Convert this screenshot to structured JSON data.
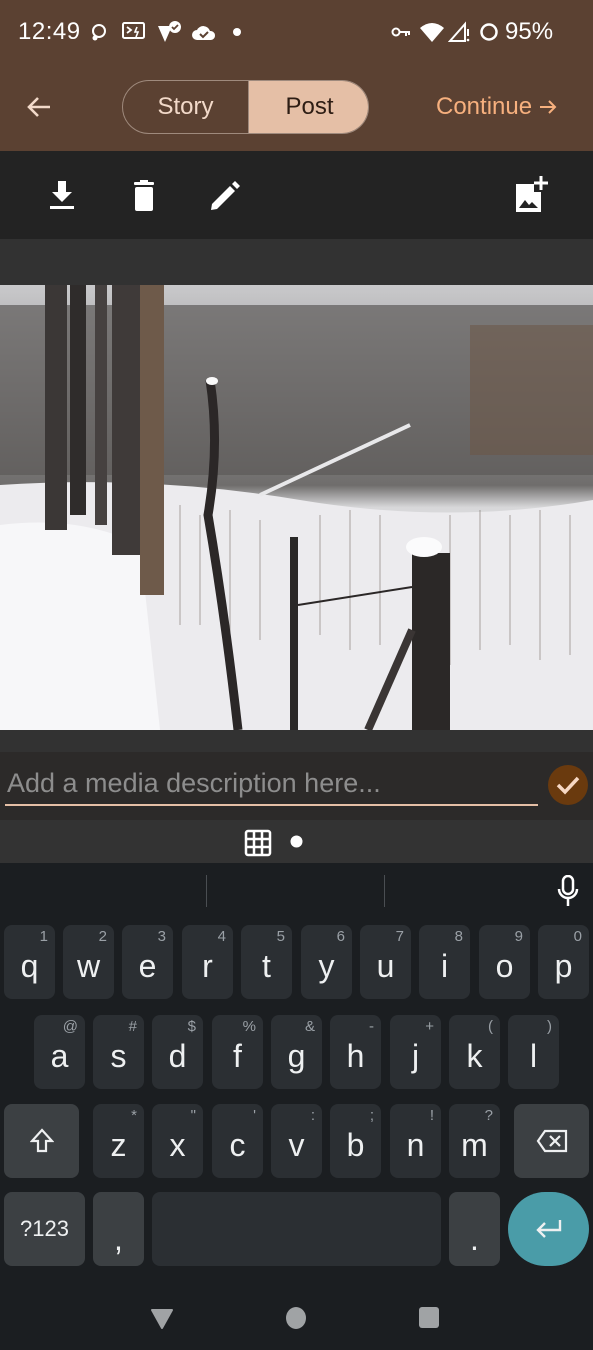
{
  "status_bar": {
    "time": "12:49",
    "left_icons": [
      "sync-icon",
      "terminal-notification-icon",
      "vpn-check-icon",
      "cloud-check-icon",
      "dot-icon"
    ],
    "right_icons": [
      "vpn-key-icon",
      "wifi-icon",
      "signal-no-data-icon",
      "battery-ring-icon"
    ],
    "battery": "95%"
  },
  "app_bar": {
    "back_icon": "arrow-left-icon",
    "segments": [
      {
        "label": "Story",
        "selected": false
      },
      {
        "label": "Post",
        "selected": true
      }
    ],
    "continue_label": "Continue",
    "continue_icon": "arrow-right-icon"
  },
  "toolbar": {
    "actions": [
      {
        "name": "download",
        "icon": "download-icon"
      },
      {
        "name": "delete",
        "icon": "trash-icon"
      },
      {
        "name": "edit",
        "icon": "pencil-icon"
      },
      {
        "name": "add-media",
        "icon": "add-photo-icon"
      }
    ]
  },
  "media": {
    "description": "Snowy forest trail with bare trees and a wooden fence post",
    "alt": "winter-forest-photo"
  },
  "caption": {
    "value": "",
    "placeholder": "Add a media description here...",
    "confirm_icon": "checkmark-icon"
  },
  "keyboard": {
    "toolbar_icons": [
      "grid-icon",
      "dot-indicator-icon"
    ],
    "mic_icon": "microphone-icon",
    "rows": [
      [
        {
          "ch": "q",
          "hint": "1"
        },
        {
          "ch": "w",
          "hint": "2"
        },
        {
          "ch": "e",
          "hint": "3"
        },
        {
          "ch": "r",
          "hint": "4"
        },
        {
          "ch": "t",
          "hint": "5"
        },
        {
          "ch": "y",
          "hint": "6"
        },
        {
          "ch": "u",
          "hint": "7"
        },
        {
          "ch": "i",
          "hint": "8"
        },
        {
          "ch": "o",
          "hint": "9"
        },
        {
          "ch": "p",
          "hint": "0"
        }
      ],
      [
        {
          "ch": "a",
          "hint": "@"
        },
        {
          "ch": "s",
          "hint": "#"
        },
        {
          "ch": "d",
          "hint": "$"
        },
        {
          "ch": "f",
          "hint": "%"
        },
        {
          "ch": "g",
          "hint": "&"
        },
        {
          "ch": "h",
          "hint": "-"
        },
        {
          "ch": "j",
          "hint": "+"
        },
        {
          "ch": "k",
          "hint": "("
        },
        {
          "ch": "l",
          "hint": ")"
        }
      ],
      [
        {
          "ch": "z",
          "hint": "*"
        },
        {
          "ch": "x",
          "hint": "\""
        },
        {
          "ch": "c",
          "hint": "'"
        },
        {
          "ch": "v",
          "hint": ":"
        },
        {
          "ch": "b",
          "hint": ";"
        },
        {
          "ch": "n",
          "hint": "!"
        },
        {
          "ch": "m",
          "hint": "?"
        }
      ]
    ],
    "shift_icon": "shift-icon",
    "backspace_icon": "backspace-icon",
    "symbols_label": "?123",
    "comma_label": ",",
    "period_label": ".",
    "enter_icon": "enter-icon"
  },
  "nav_bar": {
    "buttons": [
      "back-triangle-icon",
      "home-circle-icon",
      "recents-square-icon"
    ]
  },
  "colors": {
    "app_bar": "#5b4132",
    "accent": "#f7b07e",
    "segment_selected": "#e5bfa6",
    "confirm": "#6a3a0e",
    "enter_key": "#4a9ca8"
  }
}
